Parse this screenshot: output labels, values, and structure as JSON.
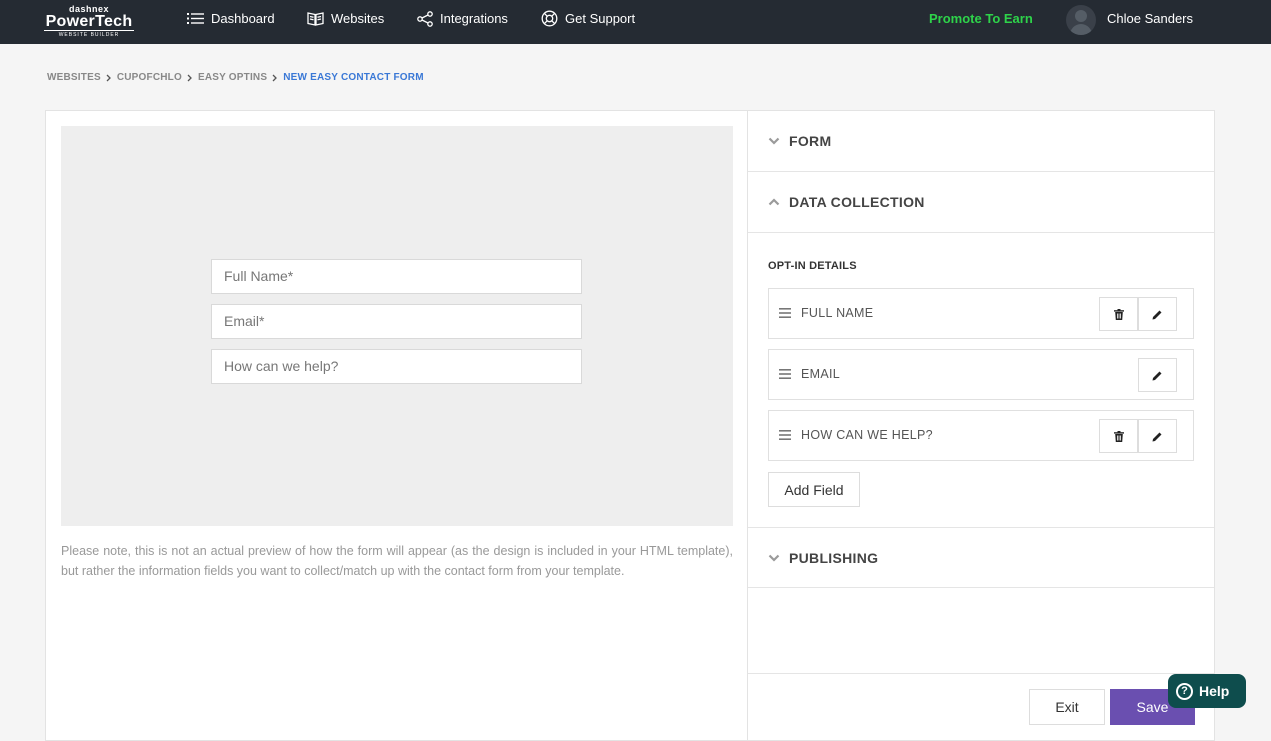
{
  "brand": {
    "top": "dashnex",
    "name": "PowerTech",
    "sub": "WEBSITE BUILDER"
  },
  "nav": {
    "dashboard": "Dashboard",
    "websites": "Websites",
    "integrations": "Integrations",
    "support": "Get Support",
    "promote": "Promote To Earn",
    "user": "Chloe Sanders"
  },
  "breadcrumb": [
    "WEBSITES",
    "CUPOFCHLO",
    "EASY OPTINS",
    "NEW EASY CONTACT FORM"
  ],
  "preview": {
    "fields": [
      "Full Name*",
      "Email*",
      "How can we help?"
    ],
    "note": "Please note, this is not an actual preview of how the form will appear (as the design is included in your HTML template), but rather the information fields you want to collect/match up with the contact form from your template."
  },
  "sections": {
    "form": "FORM",
    "data_collection": "DATA COLLECTION",
    "publishing": "PUBLISHING"
  },
  "optin": {
    "title": "OPT-IN DETAILS",
    "fields": [
      "FULL NAME",
      "EMAIL",
      "HOW CAN WE HELP?"
    ],
    "add_field": "Add Field"
  },
  "actions": {
    "exit": "Exit",
    "save": "Save",
    "help": "Help"
  },
  "colors": {
    "nav_bg": "#252b33",
    "promote": "#2ed34a",
    "accent": "#3a78d6",
    "save": "#6a4fb0",
    "help": "#0e4d4d"
  }
}
